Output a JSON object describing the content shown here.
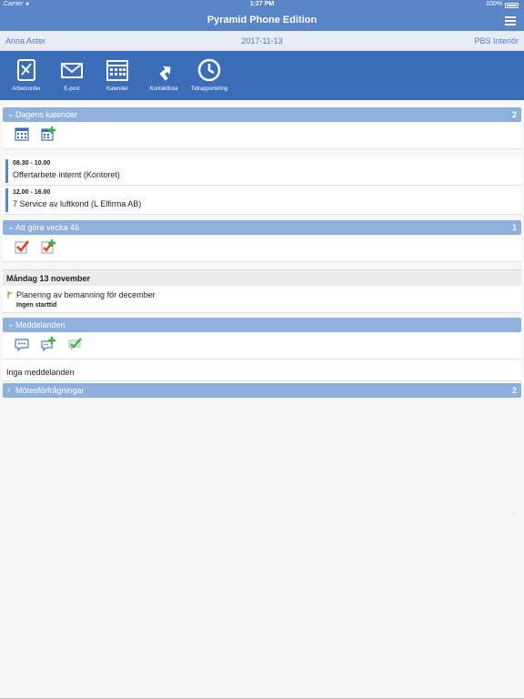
{
  "status": {
    "carrier": "Carrier",
    "time": "1:27 PM",
    "battery": "100%"
  },
  "app": {
    "title": "Pyramid Phone Edition"
  },
  "info": {
    "user": "Anna Aster",
    "date": "2017-11-13",
    "company": "PBS Interiör"
  },
  "toolbar": {
    "items": [
      {
        "label": "Arbetsorder",
        "icon": "work-order-icon"
      },
      {
        "label": "E-post",
        "icon": "envelope-icon"
      },
      {
        "label": "Kalender",
        "icon": "calendar-icon"
      },
      {
        "label": "Kontaktlista",
        "icon": "contact-arrow-icon"
      },
      {
        "label": "Tidrapportering",
        "icon": "clock-icon"
      }
    ]
  },
  "calendar": {
    "title": "Dagens kalender",
    "count": "2",
    "events": [
      {
        "time": "08.30 - 10.00",
        "text": "Offertarbete internt (Kontoret)"
      },
      {
        "time": "12.00 - 16.00",
        "text": "7 Service av luftkond (L Elfirma AB)"
      }
    ]
  },
  "todo": {
    "title": "Att göra vecka 46",
    "count": "1",
    "day": "Måndag 13 november",
    "task": {
      "text": "Planering av bemanning för december",
      "sub": "Ingen starttid"
    }
  },
  "messages": {
    "title": "Meddelanden",
    "empty": "Inga meddelanden"
  },
  "meetings": {
    "title": "Mötesförfrågningar",
    "count": "2"
  },
  "colors": {
    "header": "#5a85c7",
    "toolbar": "#3b6db9",
    "section": "#8fb0dd",
    "check": "#e03c2f",
    "plus": "#3cb043"
  }
}
